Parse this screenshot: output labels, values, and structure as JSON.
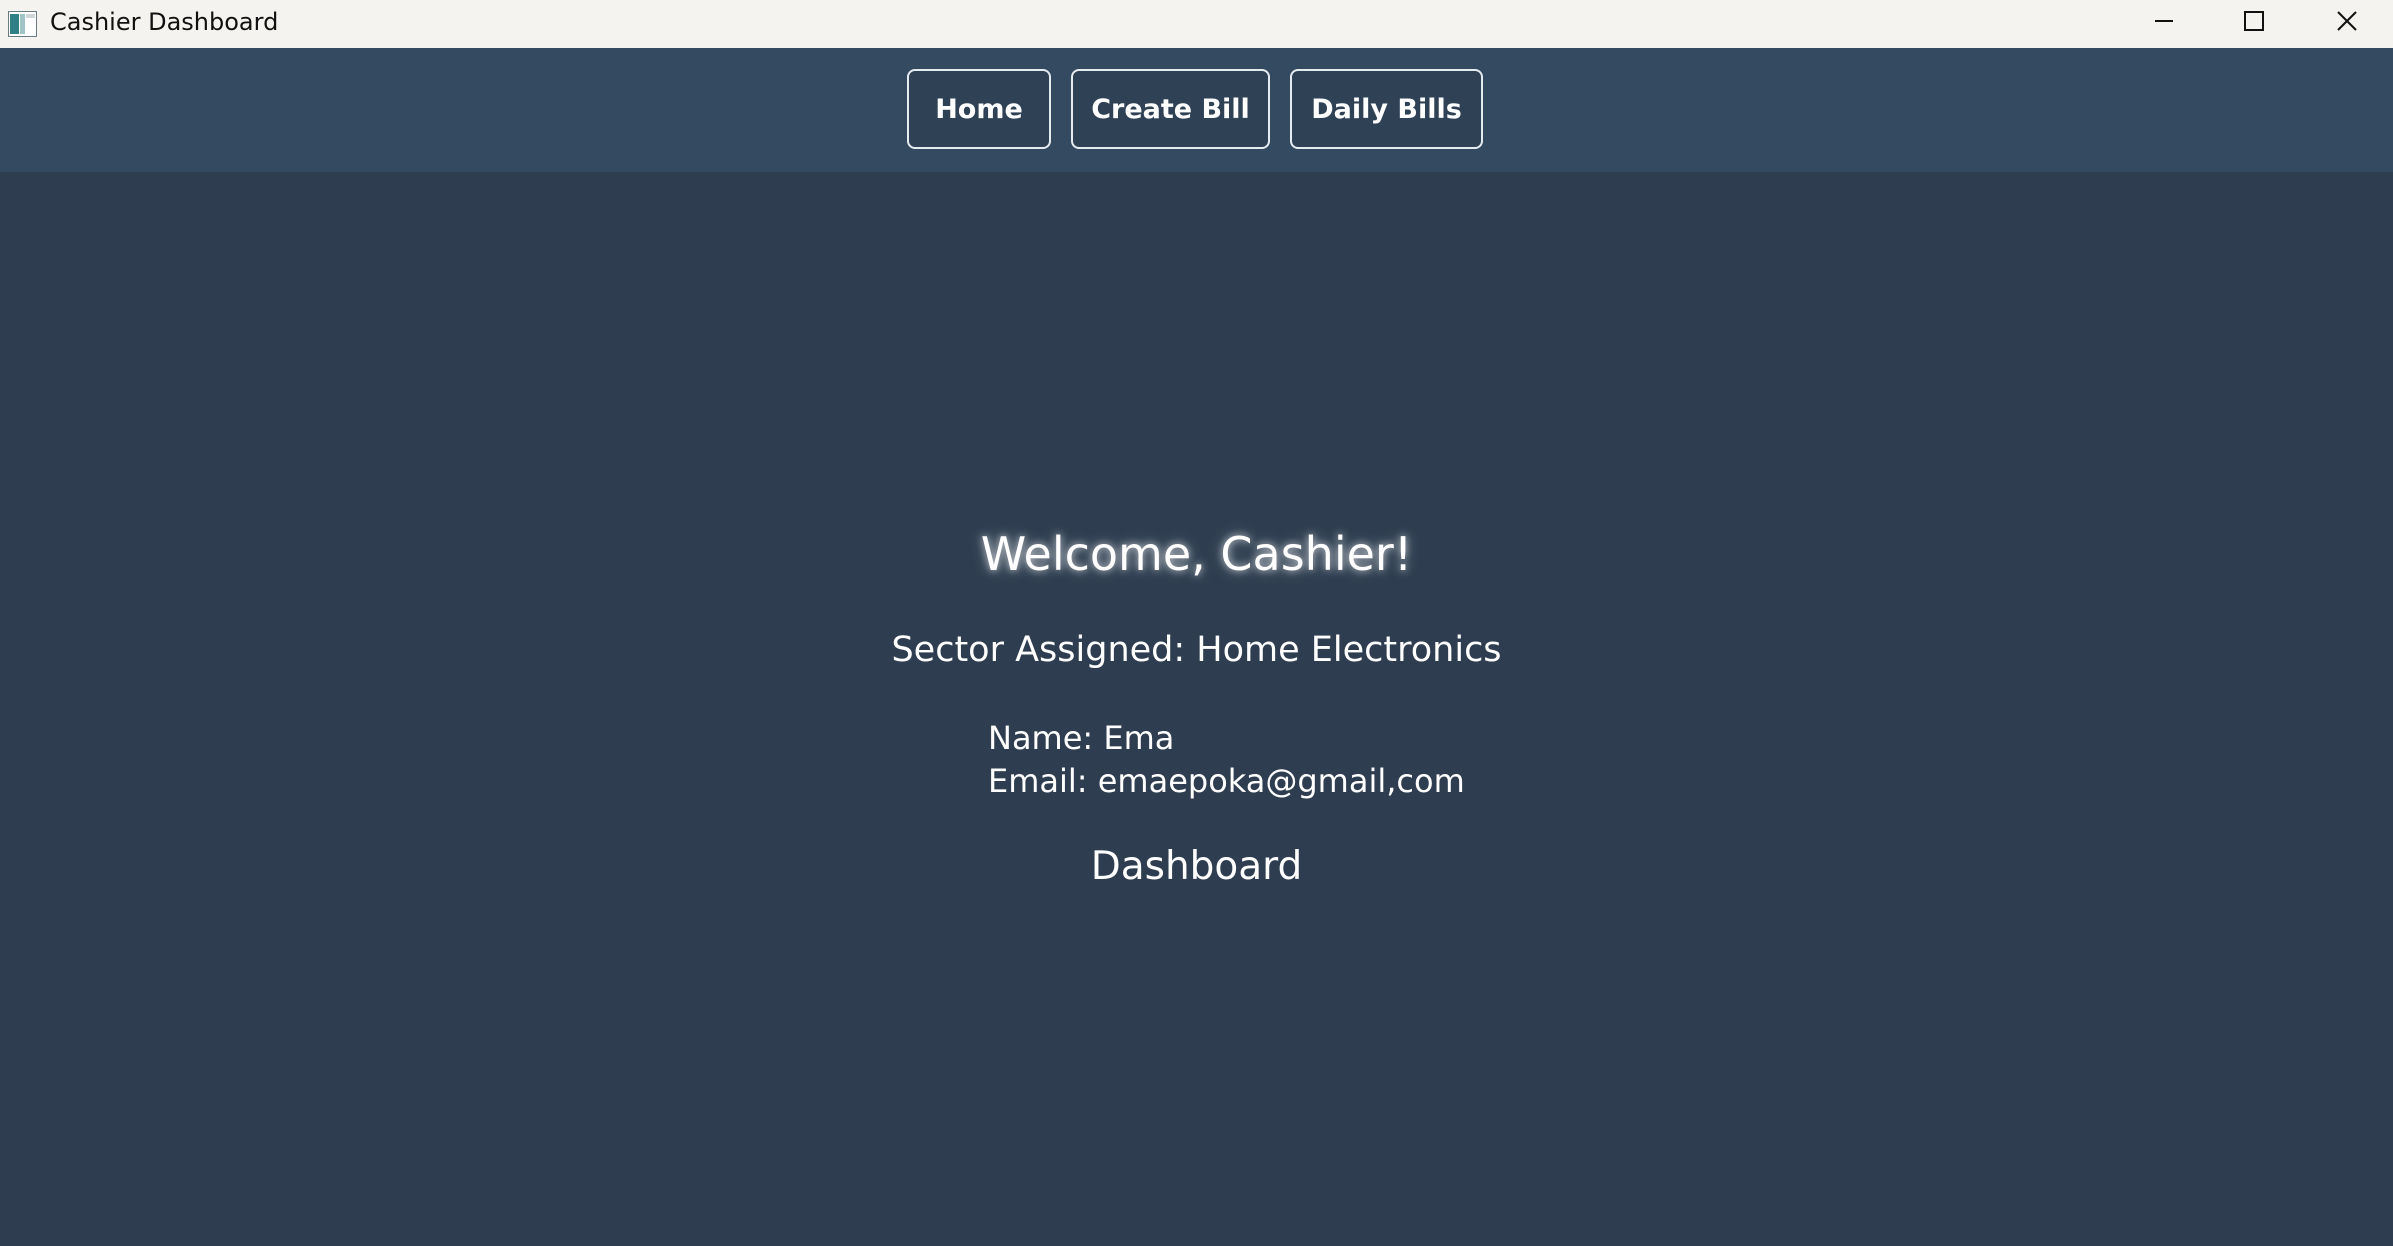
{
  "window": {
    "title": "Cashier Dashboard",
    "icon": "app-window-icon",
    "controls": [
      "minimize-icon",
      "maximize-icon",
      "close-icon"
    ]
  },
  "nav": {
    "items": [
      {
        "label": "Home"
      },
      {
        "label": "Create Bill"
      },
      {
        "label": "Daily Bills"
      }
    ]
  },
  "main": {
    "welcome": "Welcome, Cashier!",
    "sector": "Sector Assigned: Home Electronics",
    "name": "Name: Ema",
    "email": "Email: emaepoka@gmail,com",
    "section_title": "Dashboard"
  },
  "colors": {
    "titlebar_bg": "#f4f3ef",
    "navbar_bg": "#344a60",
    "content_bg": "#2e3e50",
    "button_border": "#e6ebf0",
    "text": "#ffffff"
  }
}
